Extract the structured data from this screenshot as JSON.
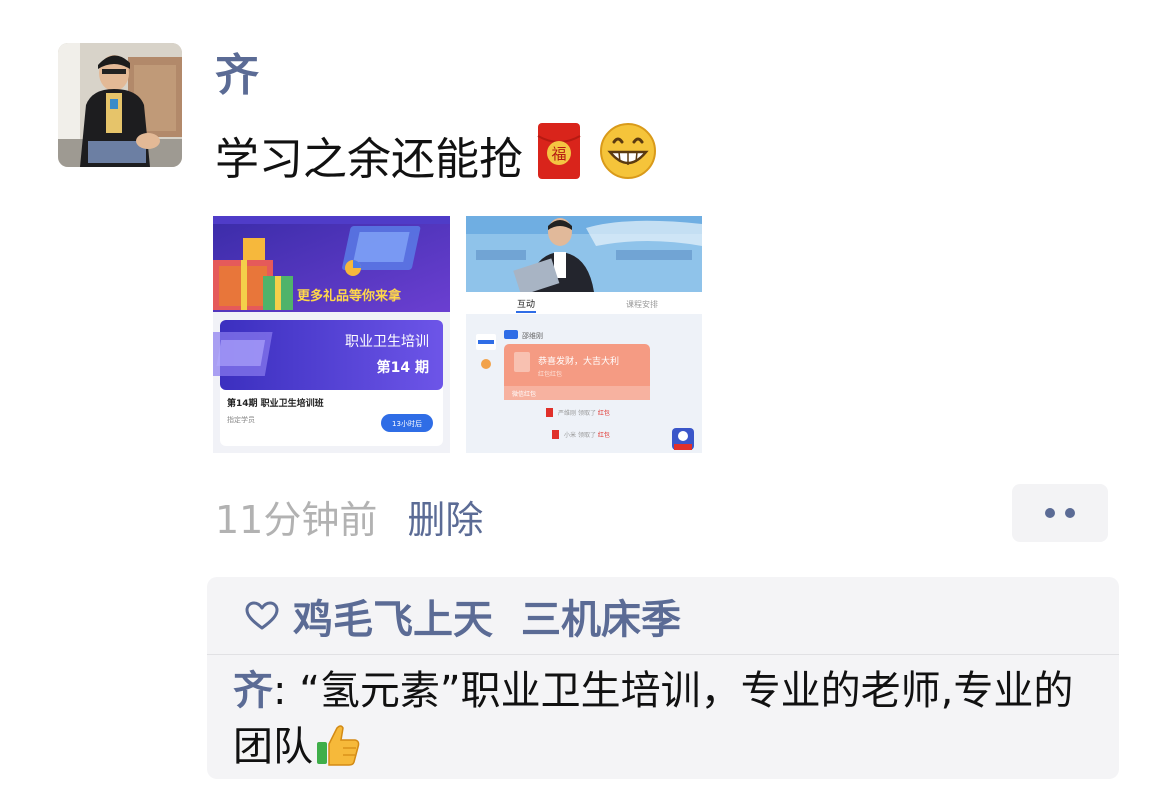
{
  "post": {
    "author": "齐",
    "text": "学习之余还能抢",
    "emojis": [
      "red-envelope-icon",
      "grinning-face-icon"
    ],
    "red_envelope_char": "福"
  },
  "images": {
    "left": {
      "banner_text": "更多礼品等你来拿",
      "card_title": "职业卫生培训",
      "card_issue": "第14 期",
      "course_name": "第14期 职业卫生培训班",
      "course_sub": "指定学员",
      "course_button": "13小时后"
    },
    "right": {
      "tab_active": "互动",
      "tab_other": "课程安排",
      "sender": "邵维刚",
      "envelope_greeting": "恭喜发财，大吉大利",
      "envelope_sub": "红包红包",
      "envelope_footer": "微信红包",
      "log1_name": "严维刚",
      "log1_action": "领取了",
      "log1_item": "红包",
      "log2_name": "小米",
      "log2_action": "领取了",
      "log2_item": "红包"
    }
  },
  "meta": {
    "time": "11分钟前",
    "delete_label": "删除"
  },
  "social": {
    "likes": [
      "鸡毛飞上天",
      "三机床季"
    ],
    "comment": {
      "author": "齐",
      "separator": ": ",
      "text": "“氢元素”职业卫生培训，专业的老师,专业的团队"
    }
  },
  "colors": {
    "link": "#5b6b95",
    "time": "#b2b2b2",
    "social_bg": "#f4f4f6",
    "envelope_red": "#d9241b"
  }
}
